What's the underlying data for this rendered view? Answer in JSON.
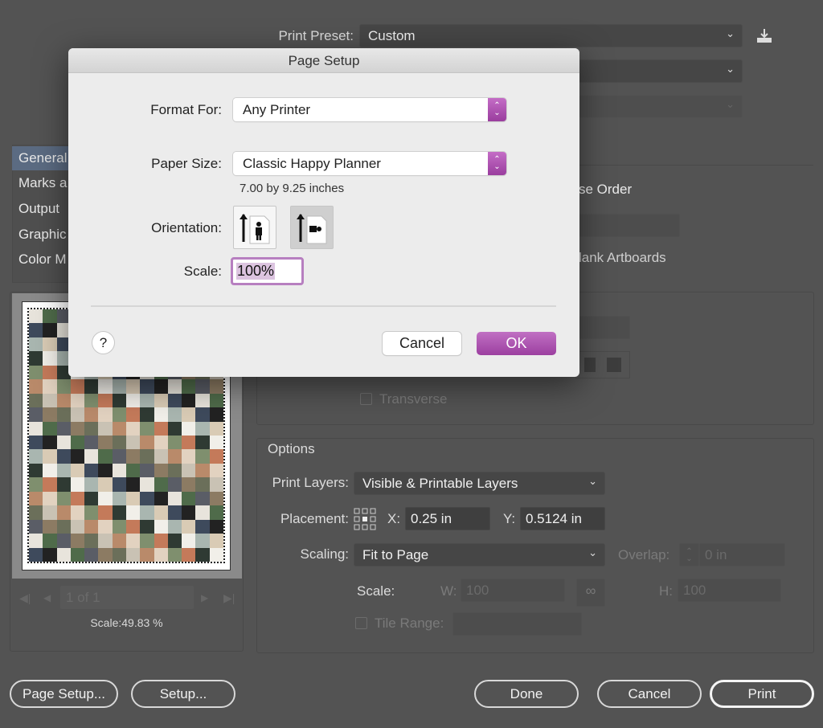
{
  "print": {
    "preset_label": "Print Preset:",
    "preset_value": "Custom",
    "sidebar": [
      "General",
      "Marks a",
      "Output",
      "Graphic",
      "Color M"
    ],
    "reverse_order_fragment": "se Order",
    "blank_artboards_fragment": "lank Artboards",
    "transverse_label": "Transverse",
    "options": {
      "heading": "Options",
      "print_layers_label": "Print Layers:",
      "print_layers_value": "Visible & Printable Layers",
      "placement_label": "Placement:",
      "x_label": "X:",
      "x_value": "0.25 in",
      "y_label": "Y:",
      "y_value": "0.5124 in",
      "scaling_label": "Scaling:",
      "scaling_value": "Fit to Page",
      "overlap_label": "Overlap:",
      "overlap_value": "0 in",
      "scale_label": "Scale:",
      "w_label": "W:",
      "w_value": "100",
      "h_label": "H:",
      "h_value": "100",
      "tile_range_label": "Tile Range:"
    },
    "preview": {
      "page_indicator": "1 of 1",
      "scale_text": "Scale:49.83 %"
    },
    "buttons": {
      "page_setup": "Page Setup...",
      "setup": "Setup...",
      "done": "Done",
      "cancel": "Cancel",
      "print": "Print"
    }
  },
  "page_setup_dialog": {
    "title": "Page Setup",
    "format_for_label": "Format For:",
    "format_for_value": "Any Printer",
    "paper_size_label": "Paper Size:",
    "paper_size_value": "Classic Happy Planner",
    "paper_dimensions": "7.00 by 9.25 inches",
    "orientation_label": "Orientation:",
    "orientation_selected": "landscape",
    "scale_label": "Scale:",
    "scale_value": "100%",
    "help_label": "?",
    "cancel_label": "Cancel",
    "ok_label": "OK",
    "accent_color": "#a24aa6"
  }
}
